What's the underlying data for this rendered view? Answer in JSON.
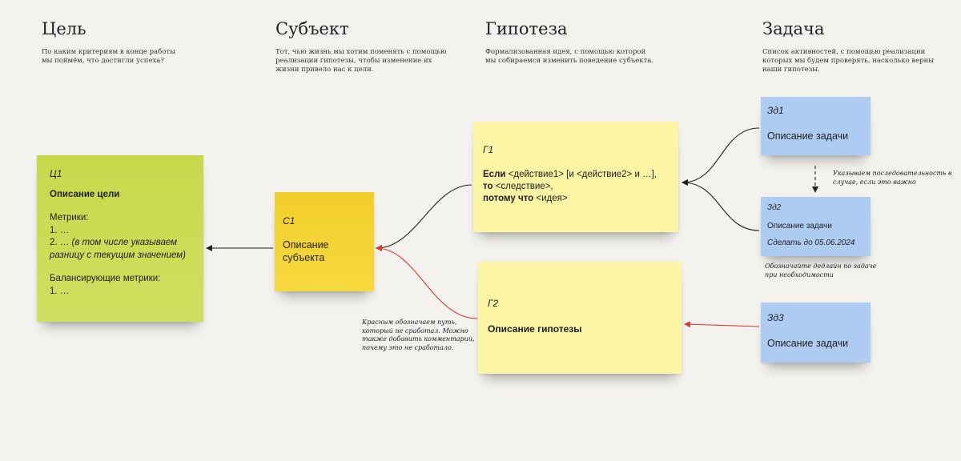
{
  "columns": [
    {
      "title": "Цель",
      "description": "По каким критериям в конце работы\nмы поймём, что достигли успеха?"
    },
    {
      "title": "Субъект",
      "description": "Тот, чью жизнь мы хотим поменять с помощью\nреализации гипотезы, чтобы изменение их\nжизни привело нас к цели."
    },
    {
      "title": "Гипотеза",
      "description": "Формализованная идея, с помощью которой\nмы собираемся изменить поведение субъекта."
    },
    {
      "title": "Задача",
      "description": "Список активностей, с помощью реализации\nкоторых мы будем проверять, насколько верны\nнаши гипотезы."
    }
  ],
  "goal": {
    "id": "Ц1",
    "title": "Описание цели",
    "metrics_label": "Метрики:",
    "metric_1": "1. …",
    "metric_2_prefix": "2. … ",
    "metric_2_note": "(в том числе указываем\nразницу с текущим значением)",
    "balancing_label": "Балансирующие метрики:",
    "balancing_1": "1. …"
  },
  "subject": {
    "id": "С1",
    "text": "Описание\nсубъекта"
  },
  "hypothesis_1": {
    "id": "Г1",
    "if_kw": "Если",
    "if_text": " <действие1> [и <действие2> и …],",
    "then_kw": "то",
    "then_text": " <следствие>,",
    "because_kw": "потому что",
    "because_text": " <идея>"
  },
  "hypothesis_2": {
    "id": "Г2",
    "text": "Описание гипотезы"
  },
  "tasks": [
    {
      "id": "Зд1",
      "text": "Описание задачи"
    },
    {
      "id": "Зд2",
      "text": "Описание задачи",
      "deadline": "Сделать до 05.06.2024"
    },
    {
      "id": "Зд3",
      "text": "Описание задачи"
    }
  ],
  "annotations": {
    "sequence": "Указываем последовательность в\nслучае, если это важно",
    "deadline": "Обозначайте дедлайн по задаче\nпри необходимости",
    "failed": "Красным обозначаем путь,\nкоторый не сработал. Можно\nтакже добавить комментарий,\nпочему это не сработало."
  },
  "colors": {
    "goal_note": "#c9dc50",
    "subject_note": "#f4d334",
    "hypothesis_note": "#fbf5a4",
    "task_note": "#aecbf2",
    "working_path": "#222222",
    "failed_path": "#d93a2b"
  }
}
